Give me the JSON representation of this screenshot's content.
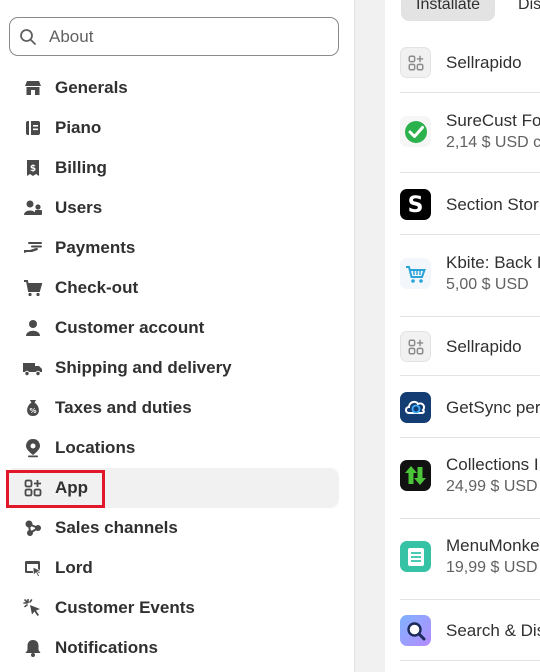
{
  "search": {
    "placeholder": "About"
  },
  "sidebar": {
    "items": [
      {
        "label": "Generals",
        "icon": "store-icon"
      },
      {
        "label": "Piano",
        "icon": "plan-icon"
      },
      {
        "label": "Billing",
        "icon": "receipt-icon"
      },
      {
        "label": "Users",
        "icon": "users-icon"
      },
      {
        "label": "Payments",
        "icon": "payment-hand-icon"
      },
      {
        "label": "Check-out",
        "icon": "cart-icon"
      },
      {
        "label": "Customer account",
        "icon": "person-icon"
      },
      {
        "label": "Shipping and delivery",
        "icon": "truck-icon"
      },
      {
        "label": "Taxes and duties",
        "icon": "tax-bag-icon"
      },
      {
        "label": "Locations",
        "icon": "location-pin-icon"
      },
      {
        "label": "App",
        "icon": "apps-icon"
      },
      {
        "label": "Sales channels",
        "icon": "channels-icon"
      },
      {
        "label": "Lord",
        "icon": "domain-icon"
      },
      {
        "label": "Customer Events",
        "icon": "cursor-click-icon"
      },
      {
        "label": "Notifications",
        "icon": "bell-icon"
      }
    ],
    "active": "App"
  },
  "tabs": [
    {
      "label": "Installate"
    },
    {
      "label": "Dis"
    }
  ],
  "apps": [
    {
      "name": "Sellrapido",
      "price": "",
      "icon": "app-placeholder-icon"
    },
    {
      "name": "SureCust Fo",
      "price": "2,14 $ USD c",
      "icon": "green-check-icon"
    },
    {
      "name": "Section Stor",
      "price": "",
      "icon": "s-logo-icon"
    },
    {
      "name": "Kbite: Back I",
      "price": "5,00 $ USD",
      "icon": "cart-logo-icon"
    },
    {
      "name": "Sellrapido",
      "price": "",
      "icon": "app-placeholder-icon"
    },
    {
      "name": "GetSync per",
      "price": "",
      "icon": "cloud-sync-icon"
    },
    {
      "name": "Collections I",
      "price": "24,99 $ USD",
      "icon": "arrows-updown-icon"
    },
    {
      "name": "MenuMonke",
      "price": "19,99 $ USD",
      "icon": "menu-list-icon"
    },
    {
      "name": "Search & Dis",
      "price": "",
      "icon": "magnifier-logo-icon"
    }
  ]
}
